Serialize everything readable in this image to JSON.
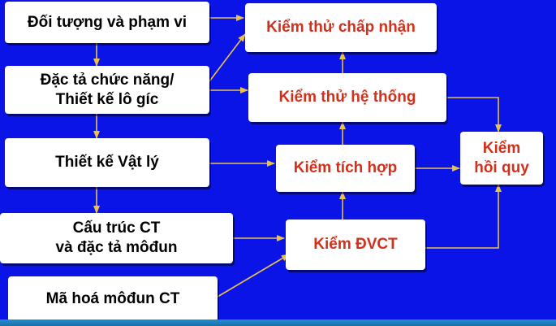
{
  "diagram": {
    "left_boxes": [
      {
        "id": "scope",
        "label": "Đối tượng và phạm vi"
      },
      {
        "id": "spec",
        "label": "Đặc tả chức năng/\nThiết kế lô gíc"
      },
      {
        "id": "phys",
        "label": "Thiết kế Vật lý"
      },
      {
        "id": "struct",
        "label": "Cấu trúc CT\nvà đặc tả môđun"
      },
      {
        "id": "code",
        "label": "Mã hoá môđun CT"
      }
    ],
    "right_boxes": [
      {
        "id": "accept",
        "label": "Kiểm thử chấp nhận"
      },
      {
        "id": "system",
        "label": "Kiểm thử hệ thống"
      },
      {
        "id": "integ",
        "label": "Kiểm tích hợp"
      },
      {
        "id": "unit",
        "label": "Kiểm ĐVCT"
      },
      {
        "id": "regress",
        "label": "Kiểm\nhồi quy"
      }
    ],
    "colors": {
      "background": "#0a14e6",
      "box": "#ffffff",
      "left_text": "#000000",
      "right_text": "#d2301a",
      "arrow": "#e8c24a"
    }
  }
}
